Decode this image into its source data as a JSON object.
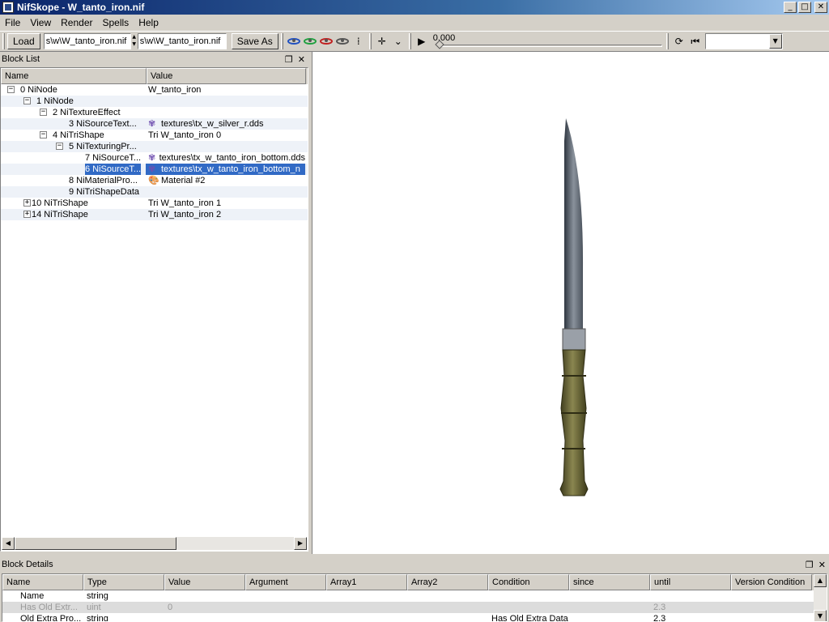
{
  "window": {
    "title": "NifSkope - W_tanto_iron.nif",
    "minimize": "_",
    "maximize": "□",
    "close": "✕"
  },
  "menu": [
    "File",
    "View",
    "Render",
    "Spells",
    "Help"
  ],
  "toolbar": {
    "load_label": "Load",
    "load_path": "s\\w\\W_tanto_iron.nif",
    "save_path": "s\\w\\W_tanto_iron.nif",
    "save_as_label": "Save As",
    "time_value": "0.000",
    "icons": [
      "eye-blue-icon",
      "eye-green-icon",
      "eye-red-icon",
      "eye-gray-icon",
      "footprints-icon",
      "axes-icon",
      "dropdown-arrow-icon",
      "play-icon",
      "loop-icon",
      "switch-icon"
    ]
  },
  "block_list": {
    "title": "Block List",
    "columns": [
      "Name",
      "Value"
    ],
    "rows": [
      {
        "num": "0",
        "name": "NiNode",
        "value": "W_tanto_iron",
        "icon": ""
      },
      {
        "num": "1",
        "name": "NiNode",
        "value": "",
        "icon": ""
      },
      {
        "num": "2",
        "name": "NiTextureEffect",
        "value": "",
        "icon": ""
      },
      {
        "num": "3",
        "name": "NiSourceText...",
        "value": "textures\\tx_w_silver_r.dds",
        "icon": "texture-icon"
      },
      {
        "num": "4",
        "name": "NiTriShape",
        "value": "Tri W_tanto_iron 0",
        "icon": ""
      },
      {
        "num": "5",
        "name": "NiTexturingPr...",
        "value": "",
        "icon": ""
      },
      {
        "num": "7",
        "name": "NiSourceT...",
        "value": "textures\\tx_w_tanto_iron_bottom.dds",
        "icon": "texture-icon"
      },
      {
        "num": "6",
        "name": "NiSourceT...",
        "value": "textures\\tx_w_tanto_iron_bottom_n",
        "icon": "texture-icon"
      },
      {
        "num": "8",
        "name": "NiMaterialPro...",
        "value": "Material #2",
        "icon": "material-icon"
      },
      {
        "num": "9",
        "name": "NiTriShapeData",
        "value": "",
        "icon": ""
      },
      {
        "num": "10",
        "name": "NiTriShape",
        "value": "Tri W_tanto_iron 1",
        "icon": ""
      },
      {
        "num": "14",
        "name": "NiTriShape",
        "value": "Tri W_tanto_iron 2",
        "icon": ""
      }
    ]
  },
  "block_details": {
    "title": "Block Details",
    "columns": [
      "Name",
      "Type",
      "Value",
      "Argument",
      "Array1",
      "Array2",
      "Condition",
      "since",
      "until",
      "Version Condition"
    ],
    "rows": [
      {
        "name": "Name",
        "type": "string",
        "value": "",
        "condition": "",
        "until": ""
      },
      {
        "name": "Has Old Extr...",
        "type": "uint",
        "value": "0",
        "condition": "",
        "until": "2.3"
      },
      {
        "name": "Old Extra Pro...",
        "type": "string",
        "value": "",
        "condition": "Has Old Extra Data",
        "until": "2.3"
      }
    ]
  },
  "colors": {
    "selection": "#316ac5",
    "titlebar": "#0a246a",
    "blade": "#6e7680",
    "handle": "#5c5a32"
  }
}
